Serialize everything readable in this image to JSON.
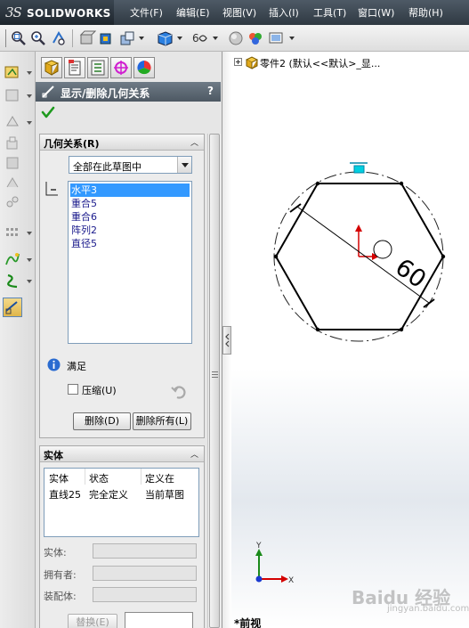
{
  "app": {
    "logo_text": "SOLIDWORKS",
    "logo_mark": "3S"
  },
  "menu": [
    {
      "label": "文件(F)"
    },
    {
      "label": "编辑(E)"
    },
    {
      "label": "视图(V)"
    },
    {
      "label": "插入(I)"
    },
    {
      "label": "工具(T)"
    },
    {
      "label": "窗口(W)"
    },
    {
      "label": "帮助(H)"
    }
  ],
  "toolbar": {
    "icons": [
      "zoom-to-fit-icon",
      "zoom-area-icon",
      "previous-view-icon",
      "section-view-icon",
      "view-orientation-icon",
      "display-style-icon",
      "hide-show-icon",
      "edit-appearance-icon",
      "apply-scene-icon",
      "view-settings-icon"
    ]
  },
  "property_manager": {
    "tabs": [
      "feature-manager-tab",
      "property-manager-tab",
      "configuration-manager-tab",
      "dimxpert-manager-tab",
      "display-manager-tab"
    ],
    "title": "显示/删除几何关系",
    "help_label": "?",
    "relations_group": {
      "title": "几何关系(R)",
      "filter": "全部在此草图中",
      "items": [
        {
          "label": "水平3",
          "selected": true
        },
        {
          "label": "重合5",
          "selected": false
        },
        {
          "label": "重合6",
          "selected": false
        },
        {
          "label": "阵列2",
          "selected": false
        },
        {
          "label": "直径5",
          "selected": false
        }
      ],
      "status_label": "满足",
      "compress_label": "压缩(U)",
      "compress_checked": false,
      "delete_label": "删除(D)",
      "delete_all_label": "删除所有(L)"
    },
    "entities_group": {
      "title": "实体",
      "columns": [
        "实体",
        "状态",
        "定义在"
      ],
      "rows": [
        [
          "直线25",
          "完全定义",
          "当前草图"
        ]
      ],
      "entity_label": "实体:",
      "owner_label": "拥有者:",
      "assembly_label": "装配体:",
      "replace_label": "替换(E)"
    }
  },
  "graphics": {
    "tree_item": "零件2  (默认<<默认>_显...",
    "dimension_value": "60",
    "view_name": "*前视",
    "triad_x": "X",
    "triad_y": "Y",
    "watermark": "Baidu 经验",
    "watermark_sub": "jingyan.baidu.com"
  },
  "colors": {
    "title_bar": "#3a4550",
    "header": "#5e6a75",
    "selection": "#3399ff",
    "hexagon": "#000000",
    "origin_red": "#d40000",
    "midpoint_cyan": "#00d0e0"
  }
}
